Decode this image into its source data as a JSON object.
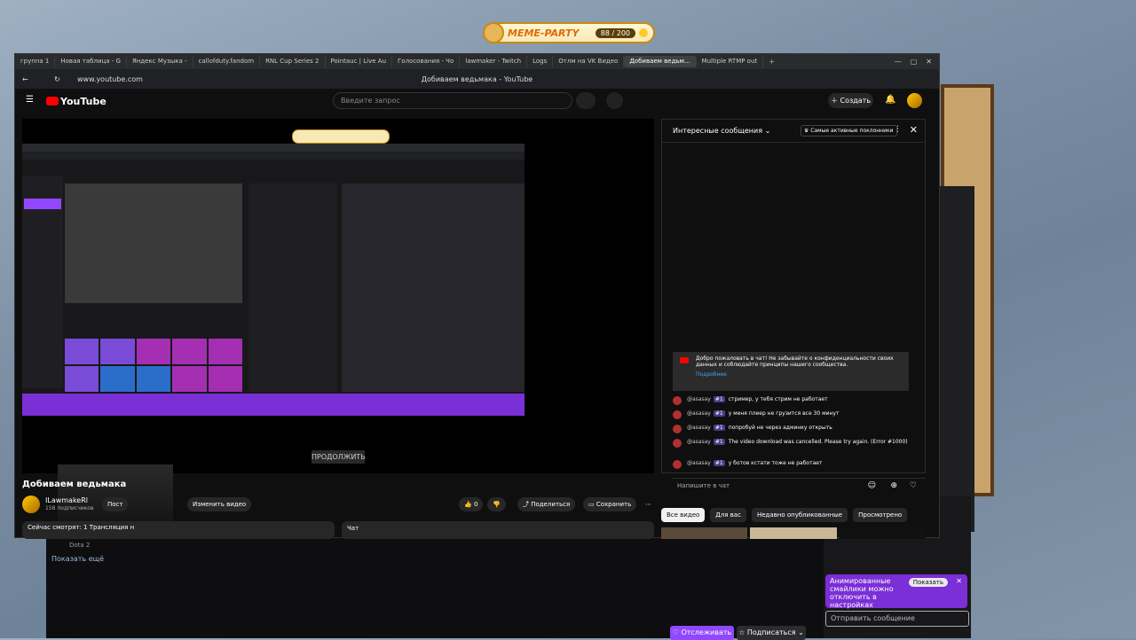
{
  "overlay": {
    "title": "MEME-PARTY",
    "counter": "88 / 200"
  },
  "tabs": [
    {
      "label": "группа 1",
      "active": false
    },
    {
      "label": "Новая таблица - G",
      "active": false
    },
    {
      "label": "Яндекс Музыка -",
      "active": false
    },
    {
      "label": "callofduty.fandom",
      "active": false
    },
    {
      "label": "RNL Cup Series 2",
      "active": false
    },
    {
      "label": "Pointauc | Live Au",
      "active": false
    },
    {
      "label": "Голосования - Чо",
      "active": false
    },
    {
      "label": "lawmaker - Twitch",
      "active": false
    },
    {
      "label": "Logs",
      "active": false
    },
    {
      "label": "Отлм на VK Видео",
      "active": false
    },
    {
      "label": "Добиваем ведьм...",
      "active": true
    },
    {
      "label": "Multiple RTMP out",
      "active": false
    }
  ],
  "address": {
    "url": "www.youtube.com",
    "page_title": "Добиваем ведьмака - YouTube"
  },
  "header": {
    "logo": "YouTube",
    "search_placeholder": "Введите запрос",
    "create_label": "Создать"
  },
  "video": {
    "continue_label": "ПРОДОЛЖИТЬ",
    "title": "Добиваем ведьмака"
  },
  "channel": {
    "name": "ILawmakeRl",
    "subs": "158 подписчиков",
    "promote": "Пост",
    "edit_label": "Изменить видео",
    "likes": "0",
    "share_label": "Поделиться",
    "save_label": "Сохранить"
  },
  "watching": {
    "text": "Сейчас смотрят: 1  Трансляция н"
  },
  "chat_box_label": "Чат",
  "chat": {
    "header": "Интересные сообщения",
    "top_label": "Самые активные поклонники",
    "welcome": "Добро пожаловать в чат! Не забывайте о конфиденциальности своих данных и соблюдайте принципы нашего сообщества.",
    "welcome_more": "Подробнее",
    "messages": [
      {
        "author": "@asasay",
        "badge": "#1",
        "text": "стример, у тебя стрим не работает"
      },
      {
        "author": "@asasay",
        "badge": "#1",
        "text": "у меня плеер не грузится все 30 минут"
      },
      {
        "author": "@asasay",
        "badge": "#1",
        "text": "попробуй не через админку открыть"
      },
      {
        "author": "@asasay",
        "badge": "#1",
        "text": "The video download was cancelled. Please try again. (Error #1000)"
      },
      {
        "author": "@asasay",
        "badge": "#1",
        "text": "у ботов кстати тоже не работает"
      }
    ],
    "input_placeholder": "Напишите в чат"
  },
  "chips": [
    "Все видео",
    "Для вас",
    "Недавно опубликованные",
    "Просмотрено"
  ],
  "twitch": {
    "notice": "Анимированные смайлики можно отключить в настройках",
    "notice_show": "Показать",
    "input_placeholder": "Отправить сообщение",
    "follow": "Отслеживать",
    "subscribe": "Подписаться",
    "show_more": "Показать ещё",
    "game": "Dota 2"
  }
}
